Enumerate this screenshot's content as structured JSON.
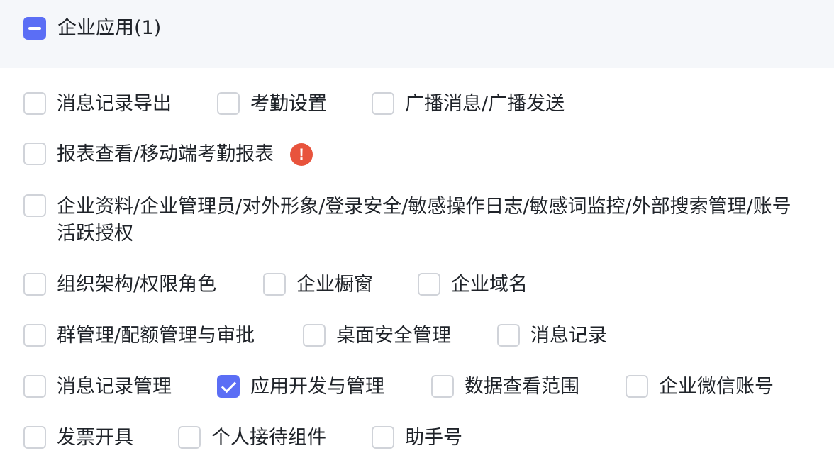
{
  "header": {
    "label": "企业应用(1)"
  },
  "items": [
    {
      "label": "消息记录导出",
      "checked": false
    },
    {
      "label": "考勤设置",
      "checked": false
    },
    {
      "label": "广播消息/广播发送",
      "checked": false
    },
    {
      "label": "报表查看/移动端考勤报表",
      "checked": false,
      "warning": "!"
    },
    {
      "label": "企业资料/企业管理员/对外形象/登录安全/敏感操作日志/敏感词监控/外部搜索管理/账号活跃授权",
      "checked": false
    },
    {
      "label": "组织架构/权限角色",
      "checked": false
    },
    {
      "label": "企业橱窗",
      "checked": false
    },
    {
      "label": "企业域名",
      "checked": false
    },
    {
      "label": "群管理/配额管理与审批",
      "checked": false
    },
    {
      "label": "桌面安全管理",
      "checked": false
    },
    {
      "label": "消息记录",
      "checked": false
    },
    {
      "label": "消息记录管理",
      "checked": false
    },
    {
      "label": "应用开发与管理",
      "checked": true
    },
    {
      "label": "数据查看范围",
      "checked": false
    },
    {
      "label": "企业微信账号",
      "checked": false
    },
    {
      "label": "发票开具",
      "checked": false
    },
    {
      "label": "个人接待组件",
      "checked": false
    },
    {
      "label": "助手号",
      "checked": false
    }
  ]
}
